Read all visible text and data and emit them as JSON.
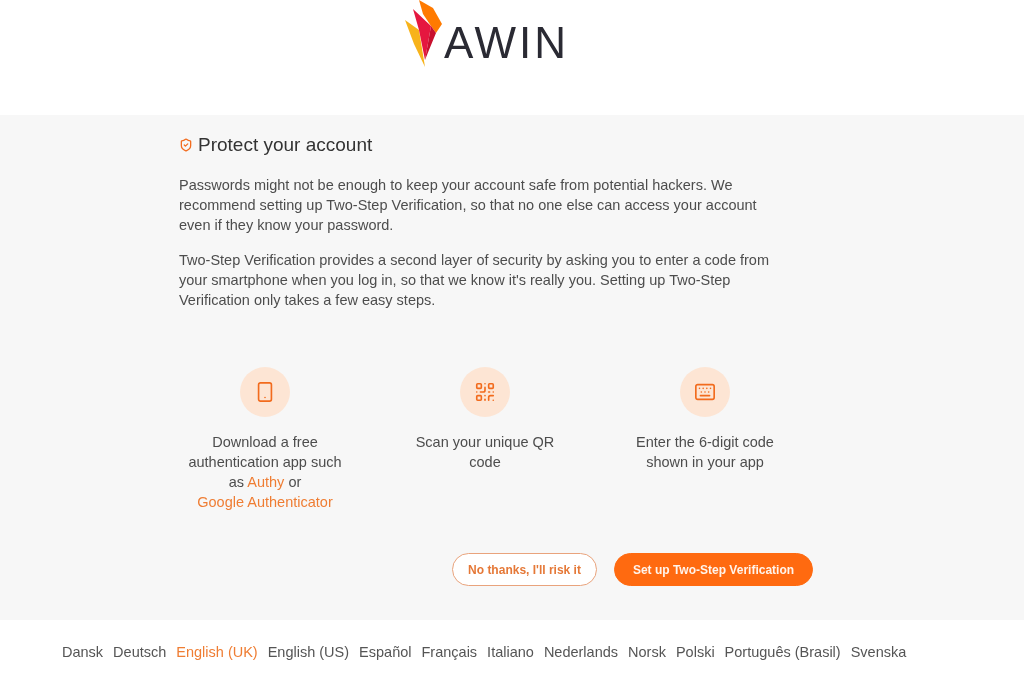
{
  "header": {
    "logo_text": "AWIN"
  },
  "intro": {
    "heading": "Protect your account",
    "paragraphs": [
      "Passwords might not be enough to keep your account safe from potential hackers. We recommend setting up Two-Step Verification, so that no one else can access your account even if they know your password.",
      "Two-Step Verification provides a second layer of security by asking you to enter a code from your smartphone when you log in, so that we know it's really you. Setting up Two-Step Verification only takes a few easy steps."
    ]
  },
  "steps": [
    {
      "kind": "phone",
      "parts": [
        {
          "kind": "text",
          "text": "Download a free authentication app such as "
        },
        {
          "kind": "link",
          "text": "Authy"
        },
        {
          "kind": "text",
          "text": " or "
        },
        {
          "kind": "link",
          "text": "Google Authenticator"
        }
      ]
    },
    {
      "kind": "qr",
      "parts": [
        {
          "kind": "text",
          "text": "Scan your unique QR code"
        }
      ]
    },
    {
      "kind": "keyboard",
      "parts": [
        {
          "kind": "text",
          "text": "Enter the 6-digit code shown in your app"
        }
      ]
    }
  ],
  "buttons": [
    {
      "kind": "secondary",
      "label": "No thanks, I'll risk it"
    },
    {
      "kind": "primary",
      "label": "Set up Two-Step Verification"
    }
  ],
  "languages": [
    {
      "label": "Dansk",
      "selected": false
    },
    {
      "label": "Deutsch",
      "selected": false
    },
    {
      "label": "English (UK)",
      "selected": true
    },
    {
      "label": "English (US)",
      "selected": false
    },
    {
      "label": "Español",
      "selected": false
    },
    {
      "label": "Français",
      "selected": false
    },
    {
      "label": "Italiano",
      "selected": false
    },
    {
      "label": "Nederlands",
      "selected": false
    },
    {
      "label": "Norsk",
      "selected": false
    },
    {
      "label": "Polski",
      "selected": false
    },
    {
      "label": "Português (Brasil)",
      "selected": false
    },
    {
      "label": "Svenska",
      "selected": false
    }
  ]
}
